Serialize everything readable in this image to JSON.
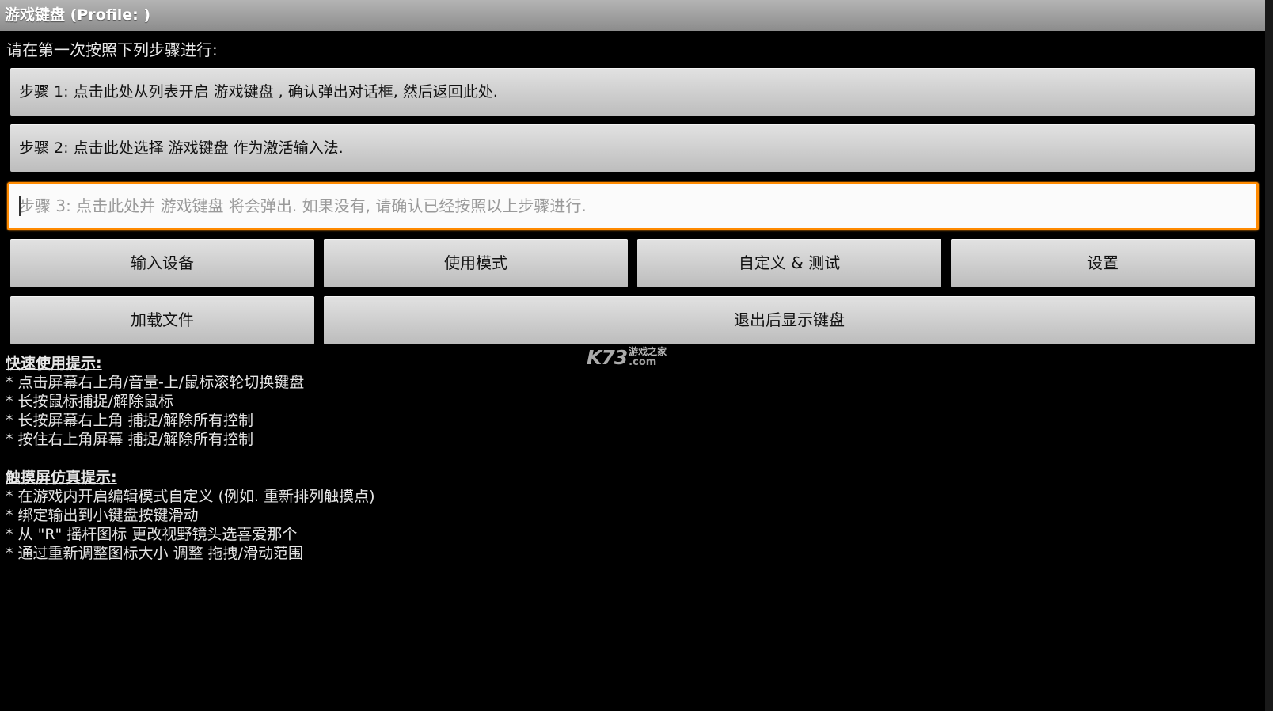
{
  "window": {
    "title": "游戏键盘 (Profile: )"
  },
  "intro": "请在第一次按照下列步骤进行:",
  "steps": [
    {
      "label": "步骤 1: 点击此处从列表开启 游戏键盘 , 确认弹出对话框, 然后返回此处."
    },
    {
      "label": "步骤 2: 点击此处选择 游戏键盘 作为激活输入法."
    }
  ],
  "step3": {
    "placeholder": "步骤 3: 点击此处并 游戏键盘 将会弹出. 如果没有, 请确认已经按照以上步骤进行.",
    "value": ""
  },
  "buttons": {
    "input_device": "输入设备",
    "usage_mode": "使用模式",
    "customize_test": "自定义 & 测试",
    "settings": "设置",
    "load_file": "加载文件",
    "show_keyboard_on_exit": "退出后显示键盘"
  },
  "quick_tips": {
    "heading": "快速使用提示:",
    "items": [
      "* 点击屏幕右上角/音量-上/鼠标滚轮切换键盘",
      "* 长按鼠标捕捉/解除鼠标",
      "* 长按屏幕右上角 捕捉/解除所有控制",
      "* 按住右上角屏幕 捕捉/解除所有控制"
    ]
  },
  "touch_tips": {
    "heading": "触摸屏仿真提示:",
    "items": [
      "* 在游戏内开启编辑模式自定义 (例如. 重新排列触摸点)",
      "* 绑定输出到小键盘按键滑动",
      "* 从 \"R\" 摇杆图标 更改视野镜头选喜爱那个",
      "* 通过重新调整图标大小 调整 拖拽/滑动范围"
    ]
  },
  "watermark": {
    "logo": "K73",
    "text": "游戏之家",
    "domain": ".com"
  },
  "colors": {
    "background": "#000000",
    "focus_accent": "#ff8a00",
    "button_face": "#d4d4d4",
    "title_bar": "#a0a0a0"
  }
}
